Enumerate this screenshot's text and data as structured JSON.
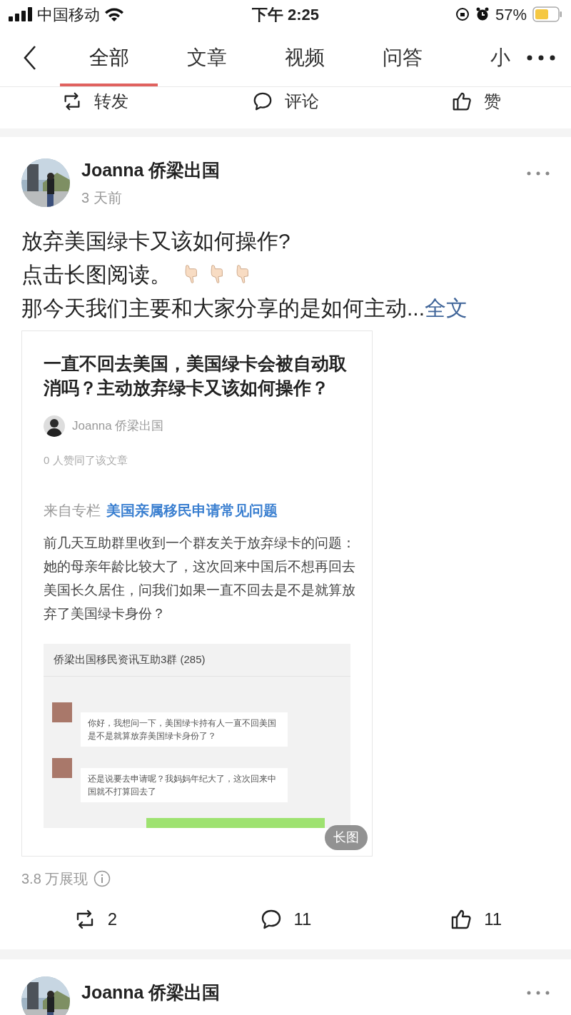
{
  "status_bar": {
    "carrier": "中国移动",
    "time": "下午 2:25",
    "battery": "57%"
  },
  "tabs": [
    {
      "label": "全部",
      "selected": true
    },
    {
      "label": "文章",
      "selected": false
    },
    {
      "label": "视频",
      "selected": false
    },
    {
      "label": "问答",
      "selected": false
    },
    {
      "label": "小",
      "selected": false
    }
  ],
  "previous_actions": [
    {
      "kind": "repost",
      "label": "转发"
    },
    {
      "kind": "comment",
      "label": "评论"
    },
    {
      "kind": "like",
      "label": "赞"
    }
  ],
  "post": {
    "author": "Joanna 侨梁出国",
    "time": "3 天前",
    "lines": [
      "放弃美国绿卡又该如何操作?",
      "点击长图阅读。"
    ],
    "excerpt": "那今天我们主要和大家分享的是如何主动...",
    "more_link": "全文",
    "long_image": {
      "title": "一直不回去美国，美国绿卡会被自动取消吗？主动放弃绿卡又该如何操作？",
      "author": "Joanna 侨梁出国",
      "likes": "0 人赞同了该文章",
      "column_label": "来自专栏",
      "column_name": "美国亲属移民申请常见问题",
      "paragraph": "前几天互助群里收到一个群友关于放弃绿卡的问题：她的母亲年龄比较大了，这次回来中国后不想再回去美国长久居住，问我们如果一直不回去是不是就算放弃了美国绿卡身份？",
      "chat": {
        "title": "侨梁出国移民资讯互助3群 (285)",
        "messages": [
          "你好，我想问一下，美国绿卡持有人一直不回美国是不是就算放弃美国绿卡身份了？",
          "还是说要去申请呢？我妈妈年纪大了，这次回来中国就不打算回去了"
        ]
      },
      "badge": "长图"
    },
    "views": "3.8 万展现",
    "actions": [
      {
        "kind": "repost",
        "count": "2"
      },
      {
        "kind": "comment",
        "count": "11"
      },
      {
        "kind": "like",
        "count": "11"
      }
    ]
  },
  "next_post": {
    "author": "Joanna 侨梁出国"
  }
}
